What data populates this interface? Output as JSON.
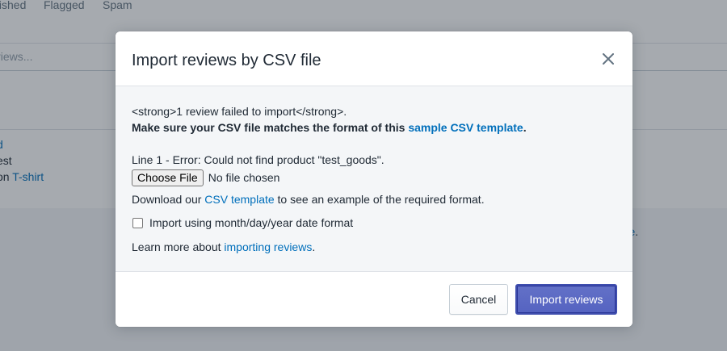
{
  "background": {
    "tabs": [
      "blished",
      "Flagged",
      "Spam"
    ],
    "search_placeholder": "eviews...",
    "rows": {
      "row1": "d",
      "row2": "est",
      "row3_prefix": "on ",
      "row3_link": "T-shirt"
    },
    "footer_link": "ere",
    "footer_suffix": "."
  },
  "modal": {
    "title": "Import reviews by CSV file",
    "close_icon": "close-icon",
    "error_summary": "<strong>1 review failed to import</strong>.",
    "format_prefix": "Make sure your CSV file matches the format of this ",
    "format_link": "sample CSV template",
    "format_suffix": ".",
    "error_line": "Line 1 - Error: Could not find product \"test_goods\".",
    "file_button": "Choose File",
    "file_status": "No file chosen",
    "download_prefix": "Download our ",
    "download_link": "CSV template",
    "download_suffix": " to see an example of the required format.",
    "checkbox_label": "Import using month/day/year date format",
    "checkbox_checked": false,
    "learn_prefix": "Learn more about ",
    "learn_link": "importing reviews",
    "learn_suffix": ".",
    "cancel_label": "Cancel",
    "import_label": "Import reviews"
  },
  "colors": {
    "link": "#006fbb",
    "primary": "#5c6ac4",
    "overlay": "rgba(33,43,54,0.4)"
  }
}
